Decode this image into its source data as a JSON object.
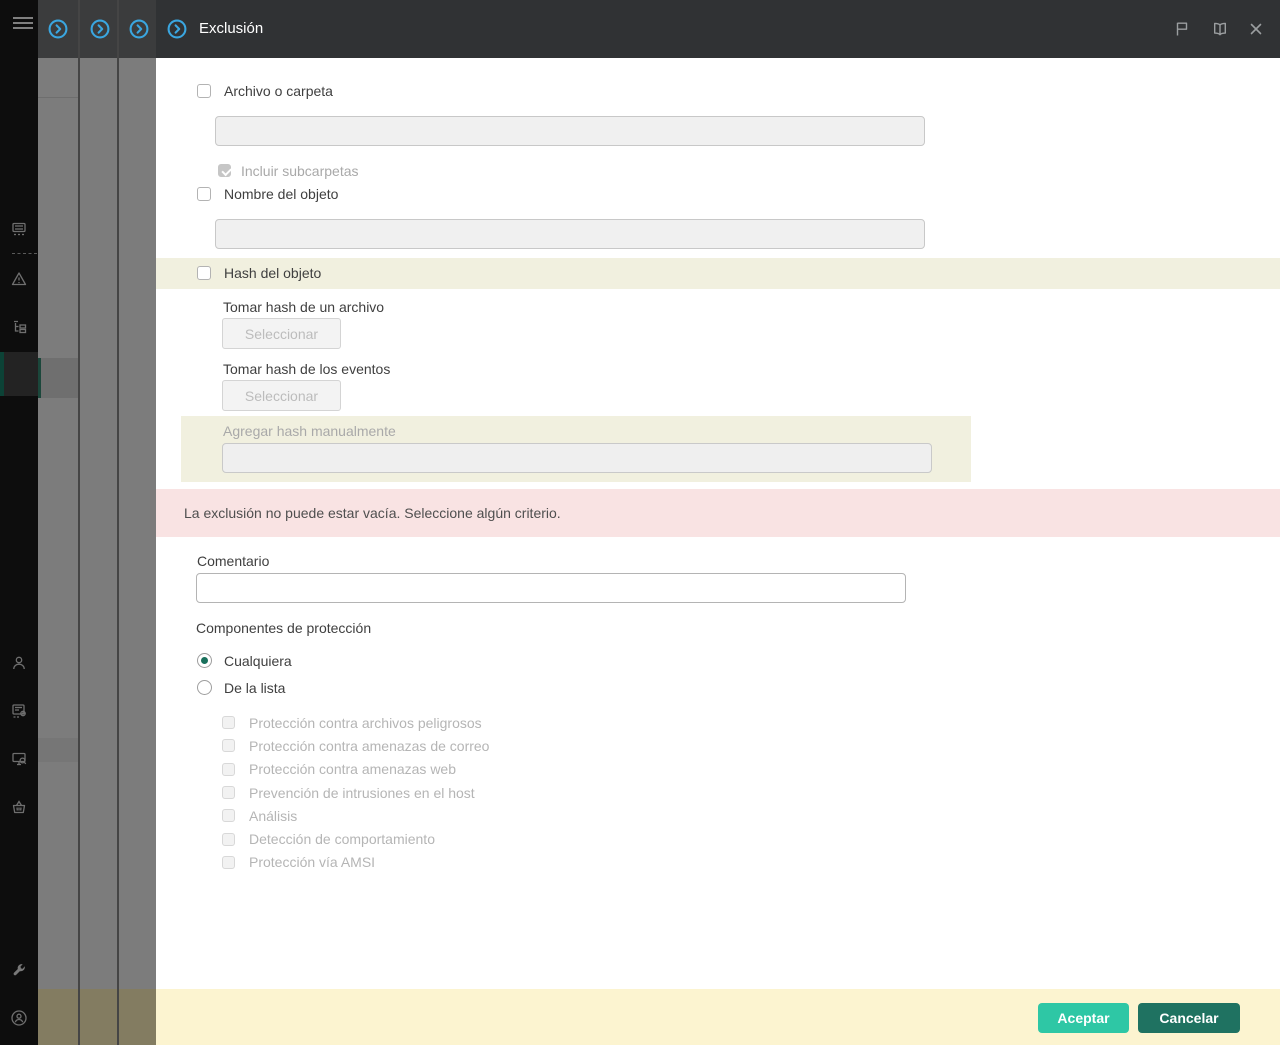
{
  "header": {
    "title": "Exclusión",
    "icons": [
      "flag-icon",
      "help-book-icon",
      "close-icon"
    ],
    "stacked_panel_icon": "circle-chevron-icon"
  },
  "sidebar": {
    "icons": [
      "menu-icon",
      "console-list-icon",
      "warning-icon",
      "hierarchy-icon",
      "selected-item",
      "user-icon",
      "document-gear-icon",
      "monitor-search-icon",
      "basket-icon",
      "wrench-icon",
      "user-circle-icon"
    ]
  },
  "form": {
    "archivo_carpeta_label": "Archivo o carpeta",
    "incluir_subcarpetas_label": "Incluir subcarpetas",
    "nombre_objeto_label": "Nombre del objeto",
    "hash_objeto_label": "Hash del objeto",
    "tomar_hash_archivo_label": "Tomar hash de un archivo",
    "tomar_hash_eventos_label": "Tomar hash de los eventos",
    "seleccionar_label": "Seleccionar",
    "agregar_hash_label": "Agregar hash manualmente",
    "error_message": "La exclusión no puede estar vacía. Seleccione algún criterio.",
    "comentario_label": "Comentario",
    "componentes_label": "Componentes de protección",
    "radios": [
      {
        "label": "Cualquiera",
        "selected": true
      },
      {
        "label": "De la lista",
        "selected": false
      }
    ],
    "protection_components": [
      "Protección contra archivos peligrosos",
      "Protección contra amenazas de correo",
      "Protección contra amenazas web",
      "Prevención de intrusiones en el host",
      "Análisis",
      "Detección de comportamiento",
      "Protección vía AMSI"
    ]
  },
  "footer": {
    "accept_label": "Aceptar",
    "cancel_label": "Cancelar"
  },
  "colors": {
    "accent_blue": "#3aa6e0",
    "selected_teal": "#0c4236",
    "radio_teal": "#19705c",
    "accept_green": "#2ec7a5",
    "cancel_green": "#1f7261",
    "highlight_yellow": "#f1f0df",
    "error_pink": "#f9e3e3",
    "footer_yellow": "#fcf4d0"
  }
}
